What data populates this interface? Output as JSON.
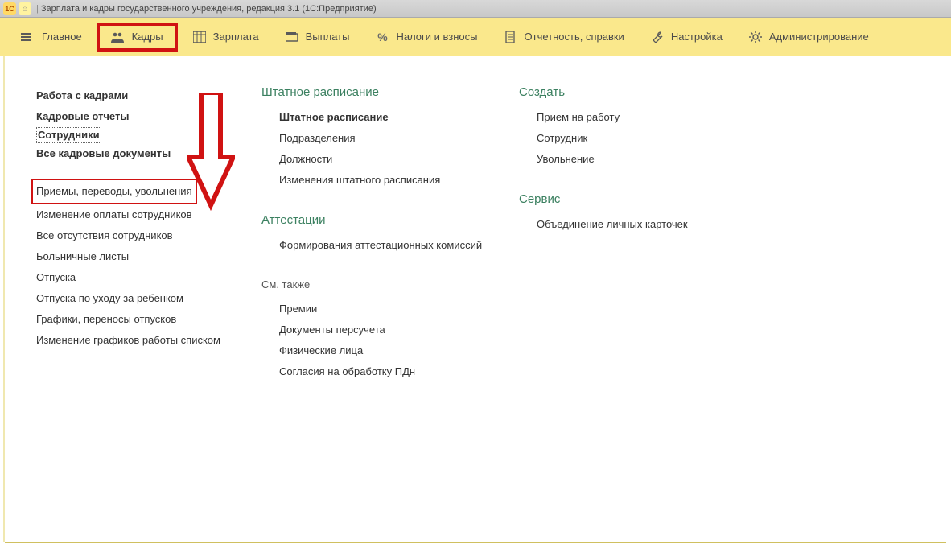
{
  "title": "Зарплата и кадры государственного учреждения, редакция 3.1  (1С:Предприятие)",
  "menu": [
    {
      "label": "Главное"
    },
    {
      "label": "Кадры"
    },
    {
      "label": "Зарплата"
    },
    {
      "label": "Выплаты"
    },
    {
      "label": "Налоги и взносы"
    },
    {
      "label": "Отчетность, справки"
    },
    {
      "label": "Настройка"
    },
    {
      "label": "Администрирование"
    }
  ],
  "left": {
    "group1": {
      "items": [
        "Работа с кадрами",
        "Кадровые отчеты",
        "Сотрудники",
        "Все кадровые документы"
      ]
    },
    "group2": {
      "items": [
        "Приемы, переводы, увольнения",
        "Изменение оплаты сотрудников",
        "Все отсутствия сотрудников",
        "Больничные листы",
        "Отпуска",
        "Отпуска по уходу за ребенком",
        "Графики, переносы отпусков",
        "Изменение графиков работы списком"
      ]
    }
  },
  "mid": {
    "staffing": {
      "heading": "Штатное расписание",
      "items": [
        "Штатное расписание",
        "Подразделения",
        "Должности",
        "Изменения штатного расписания"
      ]
    },
    "attest": {
      "heading": "Аттестации",
      "items": [
        "Формирования аттестационных комиссий"
      ]
    },
    "seealso": {
      "heading": "См. также",
      "items": [
        "Премии",
        "Документы персучета",
        "Физические лица",
        "Согласия на обработку ПДн"
      ]
    }
  },
  "right": {
    "create": {
      "heading": "Создать",
      "items": [
        "Прием на работу",
        "Сотрудник",
        "Увольнение"
      ]
    },
    "service": {
      "heading": "Сервис",
      "items": [
        "Объединение личных карточек"
      ]
    }
  }
}
